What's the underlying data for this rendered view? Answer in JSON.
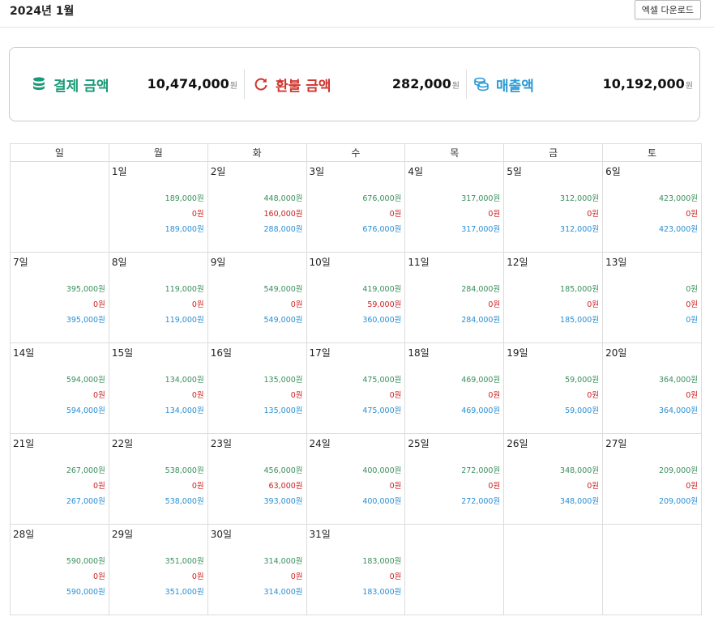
{
  "header": {
    "title": "2024년 1월",
    "excel_button": "엑셀 다운로드"
  },
  "summary": {
    "payment": {
      "label": "결제 금액",
      "value": "10,474,000",
      "unit": "원",
      "icon": "database-icon",
      "color": "#1a9a78"
    },
    "refund": {
      "label": "환불 금액",
      "value": "282,000",
      "unit": "원",
      "icon": "refresh-icon",
      "color": "#d0352f"
    },
    "sales": {
      "label": "매출액",
      "value": "10,192,000",
      "unit": "원",
      "icon": "coins-icon",
      "color": "#2b9ad6"
    }
  },
  "calendar": {
    "weekdays": [
      "일",
      "월",
      "화",
      "수",
      "목",
      "금",
      "토"
    ],
    "weeks": [
      [
        null,
        {
          "day": "1일",
          "pay": "189,000원",
          "refund": "0원",
          "sales": "189,000원"
        },
        {
          "day": "2일",
          "pay": "448,000원",
          "refund": "160,000원",
          "sales": "288,000원"
        },
        {
          "day": "3일",
          "pay": "676,000원",
          "refund": "0원",
          "sales": "676,000원"
        },
        {
          "day": "4일",
          "pay": "317,000원",
          "refund": "0원",
          "sales": "317,000원"
        },
        {
          "day": "5일",
          "pay": "312,000원",
          "refund": "0원",
          "sales": "312,000원"
        },
        {
          "day": "6일",
          "pay": "423,000원",
          "refund": "0원",
          "sales": "423,000원"
        }
      ],
      [
        {
          "day": "7일",
          "pay": "395,000원",
          "refund": "0원",
          "sales": "395,000원"
        },
        {
          "day": "8일",
          "pay": "119,000원",
          "refund": "0원",
          "sales": "119,000원"
        },
        {
          "day": "9일",
          "pay": "549,000원",
          "refund": "0원",
          "sales": "549,000원"
        },
        {
          "day": "10일",
          "pay": "419,000원",
          "refund": "59,000원",
          "sales": "360,000원"
        },
        {
          "day": "11일",
          "pay": "284,000원",
          "refund": "0원",
          "sales": "284,000원"
        },
        {
          "day": "12일",
          "pay": "185,000원",
          "refund": "0원",
          "sales": "185,000원"
        },
        {
          "day": "13일",
          "pay": "0원",
          "refund": "0원",
          "sales": "0원"
        }
      ],
      [
        {
          "day": "14일",
          "pay": "594,000원",
          "refund": "0원",
          "sales": "594,000원"
        },
        {
          "day": "15일",
          "pay": "134,000원",
          "refund": "0원",
          "sales": "134,000원"
        },
        {
          "day": "16일",
          "pay": "135,000원",
          "refund": "0원",
          "sales": "135,000원"
        },
        {
          "day": "17일",
          "pay": "475,000원",
          "refund": "0원",
          "sales": "475,000원"
        },
        {
          "day": "18일",
          "pay": "469,000원",
          "refund": "0원",
          "sales": "469,000원"
        },
        {
          "day": "19일",
          "pay": "59,000원",
          "refund": "0원",
          "sales": "59,000원"
        },
        {
          "day": "20일",
          "pay": "364,000원",
          "refund": "0원",
          "sales": "364,000원"
        }
      ],
      [
        {
          "day": "21일",
          "pay": "267,000원",
          "refund": "0원",
          "sales": "267,000원"
        },
        {
          "day": "22일",
          "pay": "538,000원",
          "refund": "0원",
          "sales": "538,000원"
        },
        {
          "day": "23일",
          "pay": "456,000원",
          "refund": "63,000원",
          "sales": "393,000원"
        },
        {
          "day": "24일",
          "pay": "400,000원",
          "refund": "0원",
          "sales": "400,000원"
        },
        {
          "day": "25일",
          "pay": "272,000원",
          "refund": "0원",
          "sales": "272,000원"
        },
        {
          "day": "26일",
          "pay": "348,000원",
          "refund": "0원",
          "sales": "348,000원"
        },
        {
          "day": "27일",
          "pay": "209,000원",
          "refund": "0원",
          "sales": "209,000원"
        }
      ],
      [
        {
          "day": "28일",
          "pay": "590,000원",
          "refund": "0원",
          "sales": "590,000원"
        },
        {
          "day": "29일",
          "pay": "351,000원",
          "refund": "0원",
          "sales": "351,000원"
        },
        {
          "day": "30일",
          "pay": "314,000원",
          "refund": "0원",
          "sales": "314,000원"
        },
        {
          "day": "31일",
          "pay": "183,000원",
          "refund": "0원",
          "sales": "183,000원"
        },
        null,
        null,
        null
      ]
    ]
  }
}
